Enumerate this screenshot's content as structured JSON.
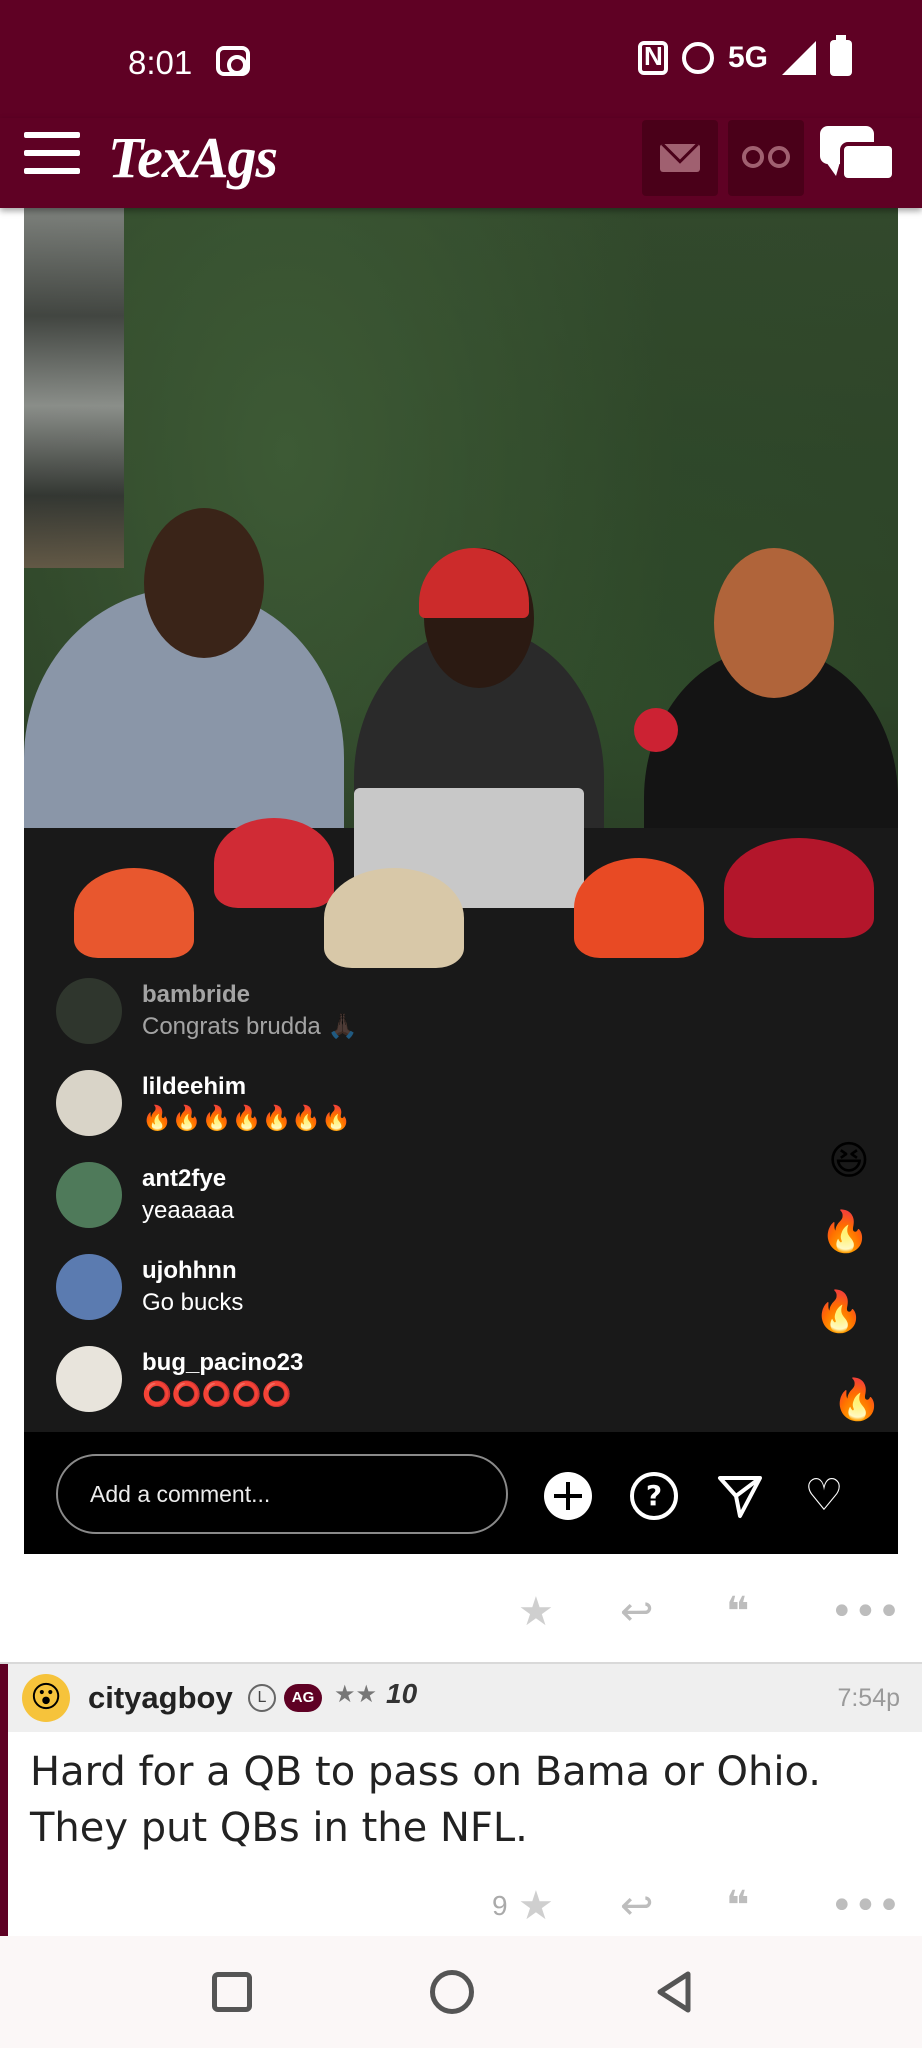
{
  "status_bar": {
    "time": "8:01",
    "network": "5G"
  },
  "header": {
    "logo_text": "TexAgs"
  },
  "video": {
    "comments": [
      {
        "user": "bambride",
        "text": "Congrats brudda 🙏🏿"
      },
      {
        "user": "lildeehim",
        "text": "🔥🔥🔥🔥🔥🔥🔥"
      },
      {
        "user": "ant2fye",
        "text": "yeaaaaa"
      },
      {
        "user": "ujohhnn",
        "text": "Go bucks"
      },
      {
        "user": "bug_pacino23",
        "text": "⭕⭕⭕⭕⭕"
      }
    ],
    "comment_placeholder": "Add a comment..."
  },
  "post": {
    "username": "cityagboy",
    "badge_l": "L",
    "badge_ag": "AG",
    "stars": "★★",
    "rank": "10",
    "time": "7:54p",
    "body": "Hard for a QB to pass on Bama or Ohio. They put QBs in the NFL.",
    "star_count": "9"
  },
  "colors": {
    "brand": "#5f0124",
    "header_dark": "#4a0019"
  }
}
